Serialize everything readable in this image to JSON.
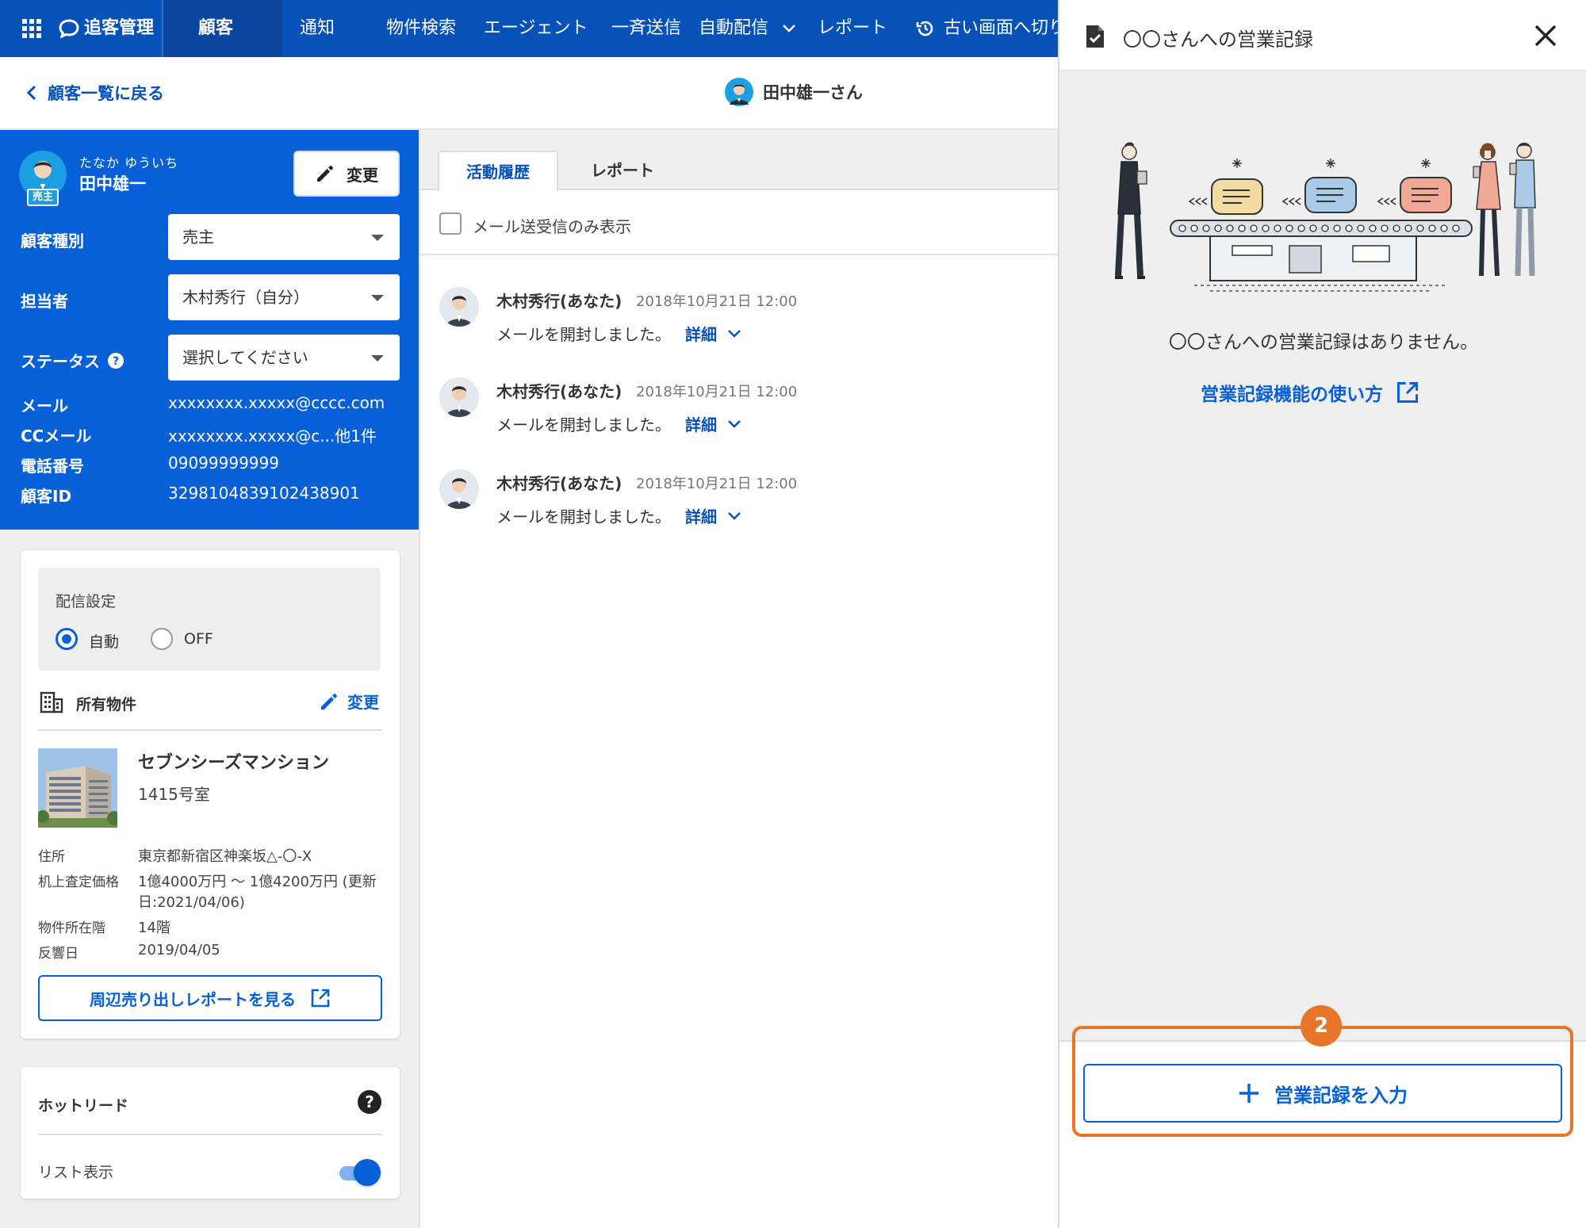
{
  "topnav": {
    "logo": "追客管理",
    "items": [
      "顧客",
      "通知",
      "物件検索",
      "エージェント",
      "一斉送信",
      "自動配信",
      "レポート"
    ],
    "old_screen": "古い画面へ切り"
  },
  "subheader": {
    "back": "顧客一覧に戻る",
    "customer_name": "田中雄一さん"
  },
  "customer": {
    "kana": "たなか ゆういち",
    "name": "田中雄一",
    "badge": "売主",
    "edit_label": "変更",
    "fields": {
      "type_label": "顧客種別",
      "type_value": "売主",
      "owner_label": "担当者",
      "owner_value": "木村秀行（自分）",
      "status_label": "ステータス",
      "status_value": "選択してください"
    },
    "info": {
      "mail_label": "メール",
      "mail_value": "xxxxxxxx.xxxxx@cccc.com",
      "cc_label": "CCメール",
      "cc_value": "xxxxxxxx.xxxxx@c...他1件",
      "tel_label": "電話番号",
      "tel_value": "09099999999",
      "id_label": "顧客ID",
      "id_value": "3298104839102438901"
    }
  },
  "distribution": {
    "title": "配信設定",
    "auto_label": "自動",
    "off_label": "OFF",
    "selected": "自動"
  },
  "property": {
    "section_title": "所有物件",
    "edit_label": "変更",
    "name": "セブンシーズマンション",
    "room": "1415号室",
    "address_label": "住所",
    "address_value": "東京都新宿区神楽坂△-〇-X",
    "price_label": "机上査定価格",
    "price_value_1": "1億4000万円 〜 1億4200万円 (更新",
    "price_value_2": "日:2021/04/06)",
    "floor_label": "物件所在階",
    "floor_value": "14階",
    "response_label": "反響日",
    "response_value": "2019/04/05",
    "report_button": "周辺売り出しレポートを見る"
  },
  "hotlead": {
    "title": "ホットリード",
    "list_label": "リスト表示",
    "toggle_on": true
  },
  "activity": {
    "tabs": [
      "活動履歴",
      "レポート"
    ],
    "filter_label": "メール送受信のみ表示",
    "items": [
      {
        "author": "木村秀行(あなた)",
        "time": "2018年10月21日 12:00",
        "message": "メールを開封しました。",
        "detail": "詳細"
      },
      {
        "author": "木村秀行(あなた)",
        "time": "2018年10月21日 12:00",
        "message": "メールを開封しました。",
        "detail": "詳細"
      },
      {
        "author": "木村秀行(あなた)",
        "time": "2018年10月21日 12:00",
        "message": "メールを開封しました。",
        "detail": "詳細"
      }
    ]
  },
  "sales_panel": {
    "title": "〇〇さんへの営業記録",
    "empty_message": "〇〇さんへの営業記録はありません。",
    "help_link": "営業記録機能の使い方",
    "add_button": "営業記録を入力",
    "step_badge": "2"
  },
  "colors": {
    "nav_blue": "#0752b8",
    "panel_blue": "#0860d8",
    "highlight_orange": "#e8742a"
  }
}
